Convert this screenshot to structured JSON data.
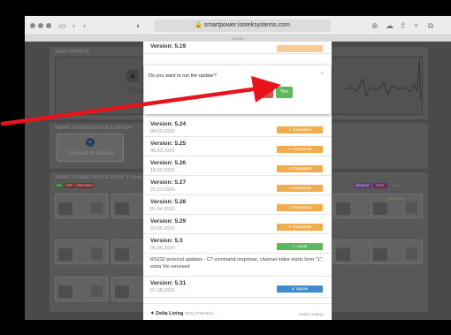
{
  "browser": {
    "url": "smartpower.isoteksystems.com",
    "tab_hint": "IsoTek"
  },
  "background": {
    "user_profile_title": "USER PROFILE",
    "user_profile_partial": "Stead",
    "smart_power_title": "SMART POWER DEVICE & GROUP",
    "connect_label": "Connect to Device",
    "outlets_title": "SMART POWER DEVICE NODE: 1 Devic",
    "mini_buttons": [
      "ON",
      "OFF",
      "RESTART"
    ],
    "right_buttons": [
      "UPDATE",
      "EXIT"
    ],
    "right_hint": "Lock",
    "card_right_label": "Subwoofer"
  },
  "confirm": {
    "question": "Do you want to run the update?",
    "no_label": "No",
    "yes_label": "Yes"
  },
  "versions": [
    {
      "name": "Version: 5.19",
      "date": "",
      "action": "",
      "kind": "orange"
    },
    {
      "name": "Version: 5.24",
      "date": "04.03.2020",
      "action": "⚠ Downgrade",
      "kind": "orange"
    },
    {
      "name": "Version: 5.25",
      "date": "05.03.2020",
      "action": "⚠ Downgrade",
      "kind": "orange"
    },
    {
      "name": "Version: 5.26",
      "date": "18.03.2020",
      "action": "⚠ Downgrade",
      "kind": "orange"
    },
    {
      "name": "Version: 5.27",
      "date": "21.03.2020",
      "action": "⚠ Downgrade",
      "kind": "orange"
    },
    {
      "name": "Version: 5.28",
      "date": "01.04.2020",
      "action": "⚠ Downgrade",
      "kind": "orange"
    },
    {
      "name": "Version: 5.29",
      "date": "29.05.2020",
      "action": "⚠ Downgrade",
      "kind": "orange"
    },
    {
      "name": "Version: 5.3",
      "date": "05.06.2020",
      "action": "✔ Actual",
      "kind": "green"
    },
    {
      "name": "Version: 5.31",
      "date": "07.08.2020",
      "action": "⬆ Update",
      "kind": "blue"
    }
  ],
  "release_note": "RS232 protocol updates - C? command response, channel index starts form \"1\", extra Vin removed",
  "footer": {
    "brand": "✦ Delta Living",
    "brand_id": "3020 (3738AB01)",
    "right": "Modes: Dialog"
  },
  "colors": {
    "arrow": "#e8141c",
    "downgrade": "#f0ad4e",
    "actual": "#5cb85c",
    "update": "#428bca",
    "no": "#d9534f",
    "yes": "#5cb85c"
  }
}
